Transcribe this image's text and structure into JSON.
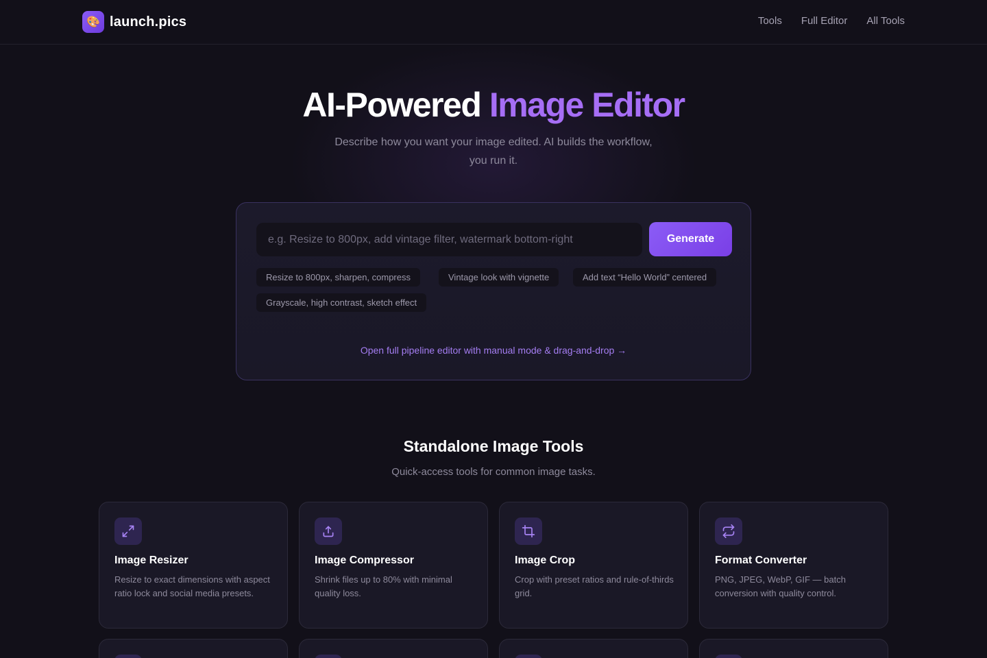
{
  "header": {
    "logo_emoji": "🎨",
    "brand": "launch.pics",
    "nav": [
      {
        "label": "Tools"
      },
      {
        "label": "Full Editor"
      },
      {
        "label": "All Tools"
      }
    ]
  },
  "hero": {
    "title_plain": "AI-Powered",
    "title_accent": "Image Editor",
    "subtitle": "Describe how you want your image edited. AI builds the workflow, you run it."
  },
  "prompt": {
    "placeholder": "e.g. Resize to 800px, add vintage filter, watermark bottom-right",
    "value": "",
    "generate_label": "Generate",
    "suggestions": [
      "Resize to 800px, sharpen, compress",
      "Vintage look with vignette",
      "Add text “Hello World” centered",
      "Grayscale, high contrast, sketch effect"
    ],
    "pipeline_link": "Open full pipeline editor with manual mode & drag-and-drop →"
  },
  "tools_section": {
    "title": "Standalone Image Tools",
    "subtitle": "Quick-access tools for common image tasks.",
    "tools": [
      {
        "name": "Image Resizer",
        "icon": "resize-icon",
        "description": "Resize to exact dimensions with aspect ratio lock and social media presets."
      },
      {
        "name": "Image Compressor",
        "icon": "upload-icon",
        "description": "Shrink files up to 80% with minimal quality loss."
      },
      {
        "name": "Image Crop",
        "icon": "crop-icon",
        "description": "Crop with preset ratios and rule-of-thirds grid."
      },
      {
        "name": "Format Converter",
        "icon": "convert-icon",
        "description": "PNG, JPEG, WebP, GIF — batch conversion with quality control."
      }
    ]
  },
  "colors": {
    "background": "#121019",
    "accent": "#a66ef5",
    "button": "#8b5cf6",
    "card": "#1a1826"
  }
}
